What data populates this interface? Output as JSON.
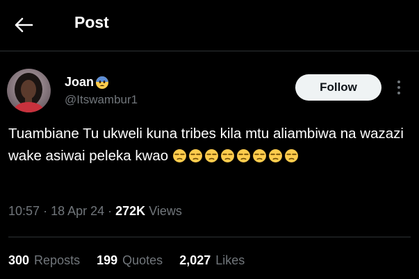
{
  "header": {
    "title": "Post",
    "back_icon": "arrow-left-icon"
  },
  "author": {
    "display_name": "Joan",
    "name_emoji": "fearful-face-emoji",
    "handle": "@Itswambur1"
  },
  "follow_label": "Follow",
  "tweet": {
    "text": "Tuambiane Tu ukweli kuna tribes kila mtu aliambiwa na wazazi wake asiwai peleka kwao",
    "emoji": "unamused-face-emoji",
    "emoji_count": 8
  },
  "meta": {
    "time": "10:57",
    "date": "18 Apr 24",
    "views_count": "272K",
    "views_label": "Views"
  },
  "stats": {
    "reposts": {
      "count": "300",
      "label": "Reposts"
    },
    "quotes": {
      "count": "199",
      "label": "Quotes"
    },
    "likes": {
      "count": "2,027",
      "label": "Likes"
    }
  },
  "colors": {
    "background": "#000000",
    "text": "#ffffff",
    "secondary_text": "#71767b",
    "border": "#2f3336",
    "follow_button_bg": "#eff3f4"
  }
}
